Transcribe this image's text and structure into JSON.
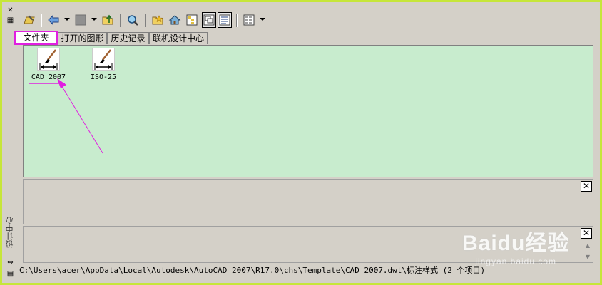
{
  "window": {
    "side_title": "设计中心",
    "pin_glyph": "⇱",
    "bottom_glyph": "▤"
  },
  "toolbar": {
    "buttons": [
      {
        "name": "load-icon"
      },
      {
        "name": "back-icon"
      },
      {
        "name": "forward-icon"
      },
      {
        "name": "up-icon"
      },
      {
        "name": "search-icon"
      },
      {
        "name": "favorites-icon"
      },
      {
        "name": "home-icon"
      },
      {
        "name": "tree-view-toggle-icon"
      },
      {
        "name": "preview-icon"
      },
      {
        "name": "description-icon"
      },
      {
        "name": "views-icon"
      }
    ]
  },
  "tabs": [
    {
      "label": "文件夹",
      "active": true
    },
    {
      "label": "打开的图形",
      "active": false
    },
    {
      "label": "历史记录",
      "active": false
    },
    {
      "label": "联机设计中心",
      "active": false
    }
  ],
  "content": {
    "items": [
      {
        "label": "CAD 2007",
        "icon": "dimension-style-icon"
      },
      {
        "label": "ISO-25",
        "icon": "dimension-style-icon"
      }
    ]
  },
  "preview_pane": {
    "close_glyph": "✕"
  },
  "description_pane": {
    "close_glyph": "✕",
    "scroll_up": "▲",
    "scroll_down": "▼"
  },
  "status": {
    "path": "C:\\Users\\acer\\AppData\\Local\\Autodesk\\AutoCAD 2007\\R17.0\\chs\\Template\\CAD 2007.dwt\\标注样式 (2 个项目)"
  },
  "watermark": {
    "brand": "Baidu经验",
    "url": "jingyan.baidu.com"
  },
  "colors": {
    "frame_border": "#c6e63a",
    "content_background": "#c8ecce",
    "annotation": "#e020e0"
  }
}
